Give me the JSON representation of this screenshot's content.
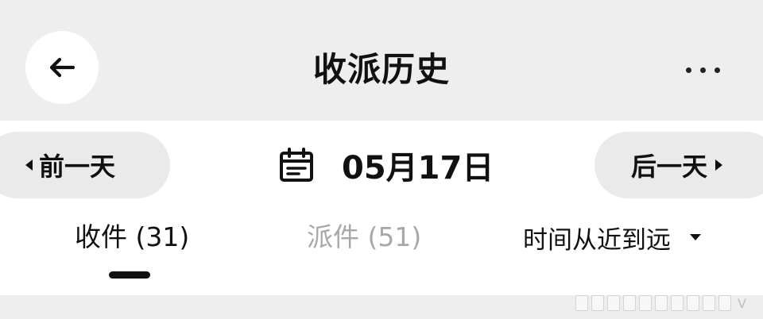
{
  "header": {
    "title": "收派历史",
    "back_icon": "arrow-left-icon",
    "more_icon": "more-horizontal-icon"
  },
  "date_nav": {
    "prev_label": "前一天",
    "next_label": "后一天",
    "current_date": "05月17日",
    "calendar_icon": "calendar-icon"
  },
  "tabs": [
    {
      "label": "收件 (31)",
      "active": true
    },
    {
      "label": "派件 (51)",
      "active": false
    }
  ],
  "sort": {
    "selected": "时间从近到远"
  },
  "watermark": {
    "text": "V"
  },
  "colors": {
    "background": "#eeeeee",
    "panel": "#ffffff",
    "active_text": "#111111",
    "inactive_text": "#a8a8a8"
  }
}
